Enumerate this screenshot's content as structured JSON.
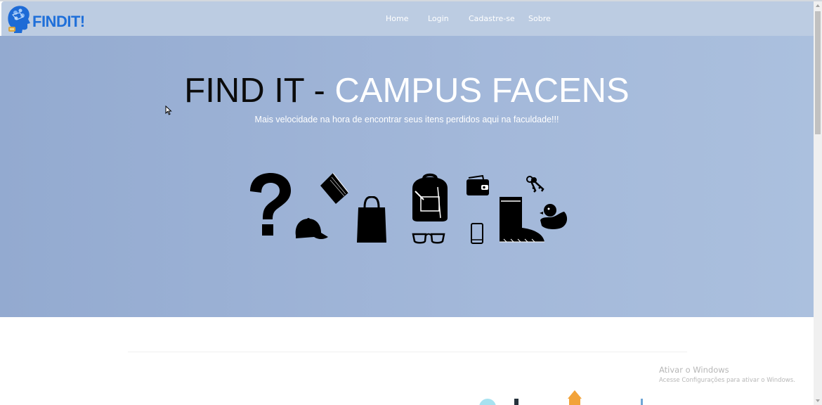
{
  "brand": {
    "logo_text": "FINDIT!",
    "accent": "#1f6fd9"
  },
  "nav": {
    "items": [
      {
        "label": "Home"
      },
      {
        "label": "Login"
      },
      {
        "label": "Cadastre-se"
      },
      {
        "label": "Sobre"
      }
    ]
  },
  "hero": {
    "title_dark": "FIND IT - ",
    "title_light": "CAMPUS FACENS",
    "subtitle": "Mais velocidade na hora de encontrar seus itens perdidos aqui na faculdade!!!",
    "background": "#a2b7d9",
    "items": [
      "question-mark-icon",
      "cap-icon",
      "book-icon",
      "shopping-bag-icon",
      "backpack-icon",
      "glasses-icon",
      "wallet-icon",
      "phone-icon",
      "boot-icon",
      "keys-icon",
      "rubber-duck-icon"
    ]
  },
  "watermark": {
    "title": "Ativar o Windows",
    "subtitle": "Acesse Configurações para ativar o Windows."
  }
}
